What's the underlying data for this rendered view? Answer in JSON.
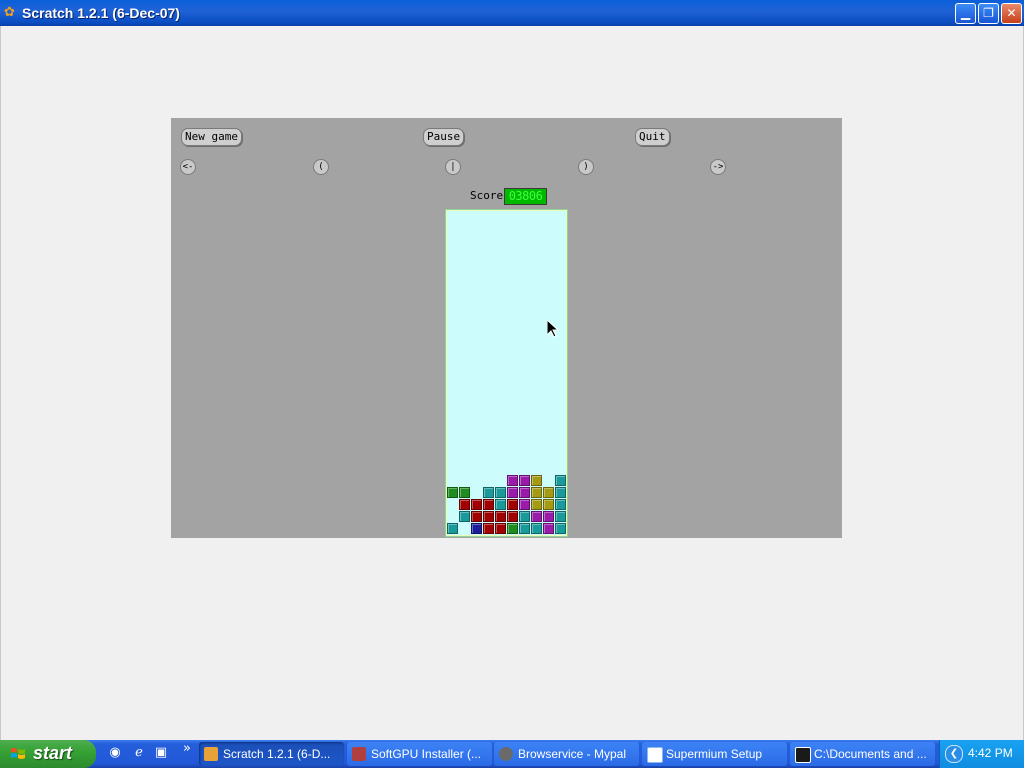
{
  "window": {
    "title": "Scratch 1.2.1 (6-Dec-07)",
    "minimize_glyph": "▁",
    "restore_glyph": "❐",
    "close_glyph": "✕"
  },
  "game": {
    "new_game_label": "New game",
    "pause_label": "Pause",
    "quit_label": "Quit",
    "controls": {
      "left": "<-",
      "rotate_ccw": "(",
      "drop": "|",
      "rotate_cw": ")",
      "right": "->"
    },
    "score_label": "Score:",
    "score_value": "03806"
  },
  "colors": {
    "green": "#1e8c1e",
    "red": "#a00000",
    "teal": "#1a9a9a",
    "purple": "#9a1aaa",
    "olive": "#a49a14",
    "blue": "#1d1d9a"
  },
  "board": {
    "cols": 10,
    "rows": 27,
    "rows_data": [
      "..........",
      "..........",
      "..........",
      "..........",
      "..........",
      "..........",
      "..........",
      "..........",
      "..........",
      "..........",
      "..........",
      "..........",
      "..........",
      "..........",
      "..........",
      "..........",
      "..........",
      "..........",
      "..........",
      "..........",
      "..........",
      "..........",
      ".....PPO.T",
      "GG.TTPPOOT",
      ".RRRTRPOOT",
      ".TRRRRTPPT",
      "T.BRRGTTPT"
    ]
  },
  "taskbar": {
    "start_label": "start",
    "tasks": [
      {
        "label": "Scratch 1.2.1 (6-D...",
        "active": true
      },
      {
        "label": "SoftGPU Installer (...",
        "active": false
      },
      {
        "label": "Browservice - Mypal",
        "active": false
      },
      {
        "label": "Supermium Setup",
        "active": false
      },
      {
        "label": "C:\\Documents and ...",
        "active": false
      }
    ],
    "quick_launch_more": "»",
    "clock": "4:42 PM"
  }
}
